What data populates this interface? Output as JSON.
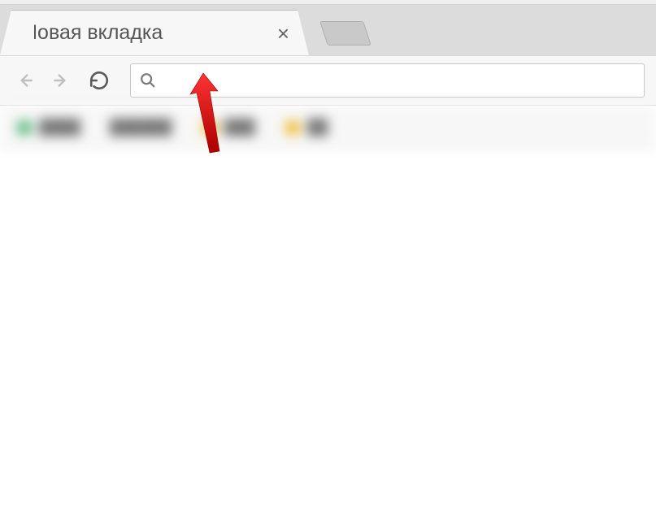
{
  "tab": {
    "title": "Новая вкладка",
    "close_label": "×"
  },
  "toolbar": {
    "back_label": "Назад",
    "forward_label": "Вперёд",
    "reload_label": "Перезагрузить"
  },
  "omnibox": {
    "value": "",
    "placeholder": ""
  },
  "annotation": {
    "arrow_color": "#d11"
  }
}
